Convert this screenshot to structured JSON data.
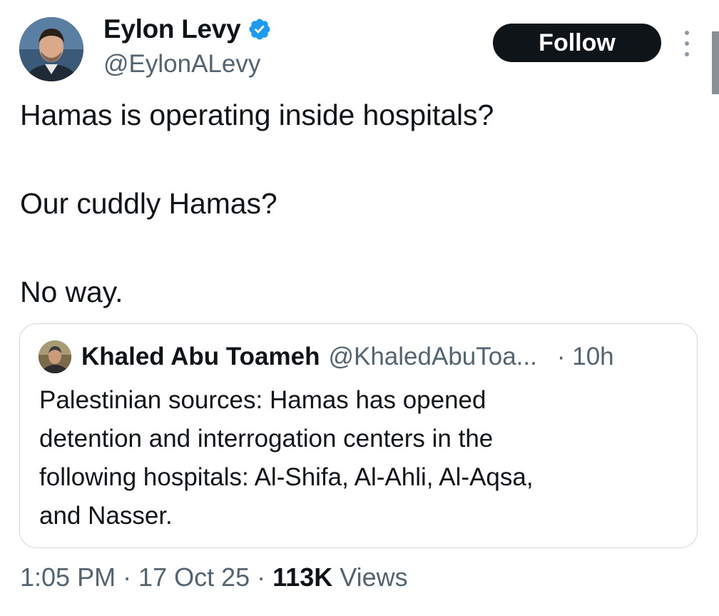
{
  "author": {
    "display_name": "Eylon Levy",
    "handle": "@EylonALevy",
    "verified_icon": "verified-badge-icon",
    "verified_color": "#1d9bf0"
  },
  "follow_button": {
    "label": "Follow"
  },
  "more_menu": {
    "icon": "more-vertical-icon"
  },
  "tweet": {
    "lines": [
      "Hamas is operating inside hospitals?",
      "Our cuddly Hamas?",
      "No way."
    ]
  },
  "quote": {
    "display_name": "Khaled Abu Toameh",
    "handle": "@KhaledAbuToa...",
    "time": "· 10h",
    "text_lines": [
      "Palestinian sources: Hamas has opened",
      "detention and interrogation centers in the",
      "following hospitals: Al-Shifa, Al-Ahli, Al-Aqsa,",
      "and Nasser."
    ]
  },
  "meta": {
    "timestamp": "1:05 PM · 17 Oct 25 · ",
    "views_count": "113K",
    "views_label": " Views"
  },
  "colors": {
    "text_primary": "#0f1419",
    "text_secondary": "#536471",
    "border": "#cfd9de",
    "follow_bg": "#0f1419"
  }
}
